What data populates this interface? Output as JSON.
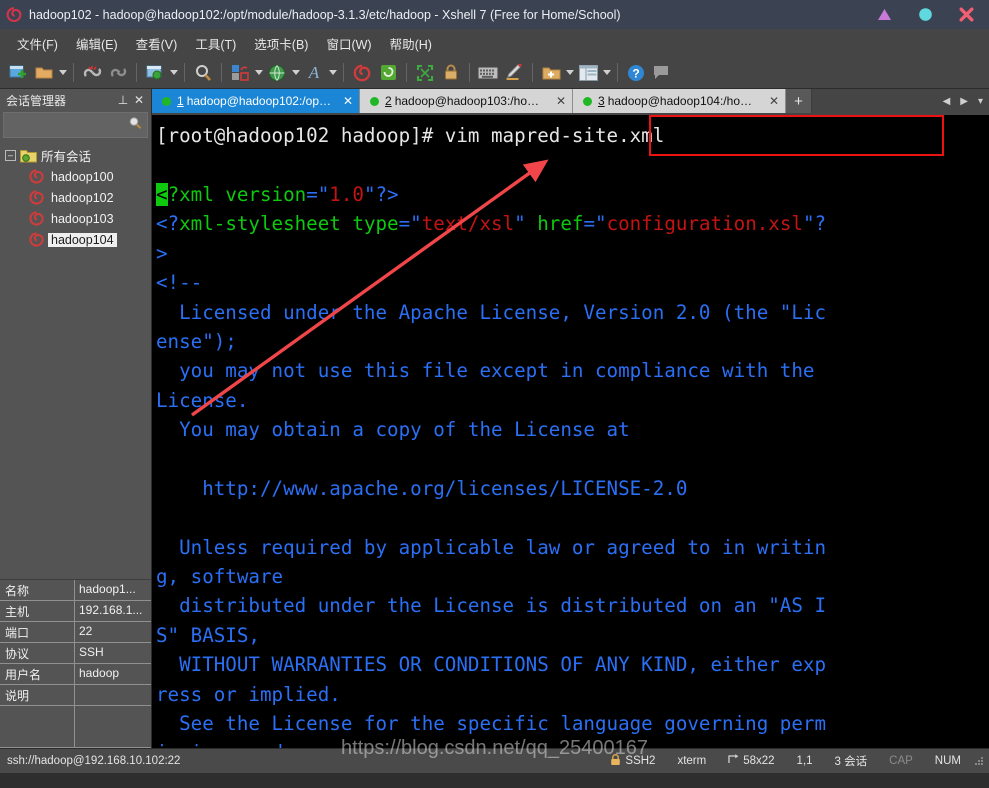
{
  "window": {
    "title": "hadoop102 - hadoop@hadoop102:/opt/module/hadoop-3.1.3/etc/hadoop - Xshell 7 (Free for Home/School)",
    "app_icon": "xshell-spiral-icon",
    "controls": [
      {
        "name": "minimize-button",
        "glyph": "triangle",
        "color": "#c77ad8"
      },
      {
        "name": "maximize-button",
        "glyph": "circle",
        "color": "#5fd8df"
      },
      {
        "name": "close-button",
        "glyph": "cross",
        "color": "#f25f72"
      }
    ]
  },
  "menubar": {
    "items": [
      {
        "label": "文件(F)"
      },
      {
        "label": "编辑(E)"
      },
      {
        "label": "查看(V)"
      },
      {
        "label": "工具(T)"
      },
      {
        "label": "选项卡(B)"
      },
      {
        "label": "窗口(W)"
      },
      {
        "label": "帮助(H)"
      }
    ]
  },
  "toolbar": {
    "groups": [
      {
        "buttons": [
          {
            "name": "new-session-icon",
            "glyph": "▤",
            "color": "#4ea3e0",
            "dropdown": false
          },
          {
            "name": "open-folder-icon",
            "glyph": "📁",
            "color": "#e0a45a",
            "dropdown": true
          }
        ]
      },
      {
        "buttons": [
          {
            "name": "disconnect-icon",
            "glyph": "⛓",
            "color": "#cf4040",
            "dropdown": false
          },
          {
            "name": "reconnect-icon",
            "glyph": "🔗",
            "color": "#8d8d8d",
            "dropdown": false
          }
        ]
      },
      {
        "buttons": [
          {
            "name": "session-properties-icon",
            "glyph": "▥",
            "color": "#7fb5dc",
            "dropdown": true
          }
        ]
      },
      {
        "buttons": [
          {
            "name": "find-icon",
            "glyph": "🔍",
            "color": "#c9c9c9",
            "dropdown": false
          }
        ]
      },
      {
        "buttons": [
          {
            "name": "layout-icon",
            "glyph": "▣",
            "color": "#4a8fd8",
            "dropdown": true
          },
          {
            "name": "encoding-globe-icon",
            "glyph": "🌐",
            "color": "#3f9b4b",
            "dropdown": true
          },
          {
            "name": "font-icon",
            "glyph": "A",
            "color": "#7aa7d6",
            "dropdown": true
          }
        ]
      },
      {
        "buttons": [
          {
            "name": "xshell-spiral-icon",
            "glyph": "@",
            "color": "#d23b3b",
            "dropdown": false
          },
          {
            "name": "xftp-icon",
            "glyph": "⬒",
            "color": "#52a832",
            "dropdown": false
          }
        ]
      },
      {
        "buttons": [
          {
            "name": "fullscreen-icon",
            "glyph": "⤢",
            "color": "#3faa3f",
            "dropdown": false
          },
          {
            "name": "lock-icon",
            "glyph": "🔒",
            "color": "#cfa063",
            "dropdown": false
          }
        ]
      },
      {
        "buttons": [
          {
            "name": "keyboard-icon",
            "glyph": "⌨",
            "color": "#c4c4c4",
            "dropdown": false
          },
          {
            "name": "highlight-pen-icon",
            "glyph": "✎",
            "color": "#d8a24a",
            "dropdown": false
          }
        ]
      },
      {
        "buttons": [
          {
            "name": "add-to-folder-icon",
            "glyph": "🗂",
            "color": "#ddac63",
            "dropdown": true
          },
          {
            "name": "panes-layout-icon",
            "glyph": "◫",
            "color": "#d0d8de",
            "dropdown": true
          }
        ]
      },
      {
        "buttons": [
          {
            "name": "help-icon",
            "glyph": "?",
            "color": "#2f86d4",
            "dropdown": false
          },
          {
            "name": "feedback-icon",
            "glyph": "🗨",
            "color": "#9a9a9a",
            "dropdown": false
          }
        ]
      }
    ]
  },
  "sidebar": {
    "title": "会话管理器",
    "pin_glyph": "⊥",
    "close_glyph": "✕",
    "search_placeholder": "",
    "search_icon": "search-icon",
    "tree": {
      "root_label": "所有会话",
      "expanded_glyph": "–",
      "items": [
        {
          "label": "hadoop100",
          "selected": false
        },
        {
          "label": "hadoop102",
          "selected": false
        },
        {
          "label": "hadoop103",
          "selected": false
        },
        {
          "label": "hadoop104",
          "selected": true
        }
      ]
    },
    "properties": [
      {
        "key": "名称",
        "value": "hadoop1..."
      },
      {
        "key": "主机",
        "value": "192.168.1..."
      },
      {
        "key": "端口",
        "value": "22"
      },
      {
        "key": "协议",
        "value": "SSH"
      },
      {
        "key": "用户名",
        "value": "hadoop"
      },
      {
        "key": "说明",
        "value": ""
      }
    ]
  },
  "tabs": {
    "items": [
      {
        "num": "1",
        "title": "hadoop@hadoop102:/opt/...",
        "active": true,
        "status": "connected"
      },
      {
        "num": "2",
        "title": "hadoop@hadoop103:/home...",
        "active": false,
        "status": "connected"
      },
      {
        "num": "3",
        "title": "hadoop@hadoop104:/home...",
        "active": false,
        "status": "connected"
      }
    ],
    "new_tab_glyph": "+",
    "nav_prev_glyph": "◀",
    "nav_next_glyph": "▶",
    "nav_list_glyph": "▾"
  },
  "terminal": {
    "prompt": "[root@hadoop102 hadoop]#",
    "command": "vim mapred-site.xml",
    "annotation": {
      "box_color": "#ee1111",
      "arrow_color": "#f0464a"
    },
    "lines": [
      {
        "segs": [
          {
            "t": "[root@hadoop102 hadoop]#",
            "c": "c-white"
          },
          {
            "t": " vim mapred-site.xml",
            "c": "c-white"
          }
        ]
      },
      {
        "segs": []
      },
      {
        "segs": [
          {
            "t": "<",
            "c": "c-blue cursor"
          },
          {
            "t": "?xml version",
            "c": "c-green"
          },
          {
            "t": "=\"",
            "c": "c-blue"
          },
          {
            "t": "1.0",
            "c": "c-red"
          },
          {
            "t": "\"?>",
            "c": "c-blue"
          }
        ]
      },
      {
        "segs": [
          {
            "t": "<?",
            "c": "c-blue"
          },
          {
            "t": "xml-stylesheet type",
            "c": "c-green"
          },
          {
            "t": "=\"",
            "c": "c-blue"
          },
          {
            "t": "text/xsl",
            "c": "c-red"
          },
          {
            "t": "\" ",
            "c": "c-blue"
          },
          {
            "t": "href",
            "c": "c-green"
          },
          {
            "t": "=\"",
            "c": "c-blue"
          },
          {
            "t": "configuration.xsl",
            "c": "c-red"
          },
          {
            "t": "\"?",
            "c": "c-blue"
          }
        ]
      },
      {
        "segs": [
          {
            "t": ">",
            "c": "c-blue"
          }
        ]
      },
      {
        "segs": [
          {
            "t": "<!--",
            "c": "c-blue"
          }
        ]
      },
      {
        "segs": [
          {
            "t": "  Licensed under the Apache License, Version 2.0 (the \"Lic",
            "c": "c-blue"
          }
        ]
      },
      {
        "segs": [
          {
            "t": "ense\");",
            "c": "c-blue"
          }
        ]
      },
      {
        "segs": [
          {
            "t": "  you may not use this file except in compliance with the",
            "c": "c-blue"
          }
        ]
      },
      {
        "segs": [
          {
            "t": "License.",
            "c": "c-blue"
          }
        ]
      },
      {
        "segs": [
          {
            "t": "  You may obtain a copy of the License at",
            "c": "c-blue"
          }
        ]
      },
      {
        "segs": []
      },
      {
        "segs": [
          {
            "t": "    http://www.apache.org/licenses/LICENSE-2.0",
            "c": "c-blue"
          }
        ]
      },
      {
        "segs": []
      },
      {
        "segs": [
          {
            "t": "  Unless required by applicable law or agreed to in writin",
            "c": "c-blue"
          }
        ]
      },
      {
        "segs": [
          {
            "t": "g, software",
            "c": "c-blue"
          }
        ]
      },
      {
        "segs": [
          {
            "t": "  distributed under the License is distributed on an \"AS I",
            "c": "c-blue"
          }
        ]
      },
      {
        "segs": [
          {
            "t": "S\" BASIS,",
            "c": "c-blue"
          }
        ]
      },
      {
        "segs": [
          {
            "t": "  WITHOUT WARRANTIES OR CONDITIONS OF ANY KIND, either exp",
            "c": "c-blue"
          }
        ]
      },
      {
        "segs": [
          {
            "t": "ress or implied.",
            "c": "c-blue"
          }
        ]
      },
      {
        "segs": [
          {
            "t": "  See the License for the specific language governing perm",
            "c": "c-blue"
          }
        ]
      },
      {
        "segs": [
          {
            "t": "issions and",
            "c": "c-blue"
          }
        ]
      }
    ]
  },
  "statusbar": {
    "connection": "ssh://hadoop@192.168.10.102:22",
    "security": "SSH2",
    "lock_icon": "lock-icon",
    "terminal_type": "xterm",
    "size_icon": "resize-icon",
    "size": "58x22",
    "cursor_pos": "1,1",
    "sessions": "3 会话",
    "caps": "CAP",
    "num": "NUM",
    "watermark": "https://blog.csdn.net/qq_25400167"
  }
}
